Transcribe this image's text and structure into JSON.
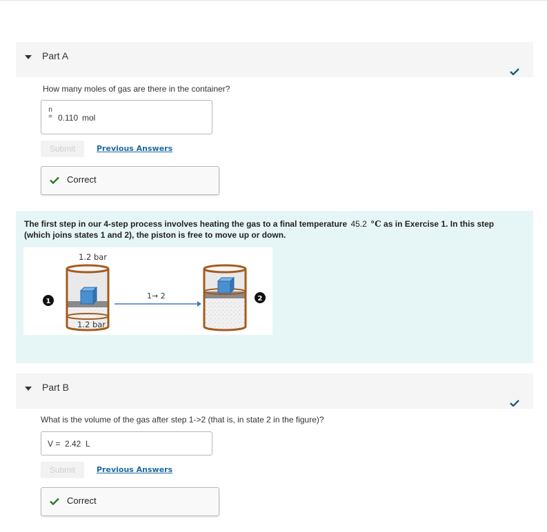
{
  "partA": {
    "title": "Part A",
    "question": "How many moles of gas are there in the container?",
    "answer_label_top": "n",
    "answer_label_bottom": "=",
    "answer_value": "0.110",
    "answer_unit": "mol",
    "submit_label": "Submit",
    "previous_answers_label": "Previous Answers",
    "feedback_label": "Correct"
  },
  "info": {
    "text_before": "The first step in our 4-step process involves heating the gas to a final temperature ",
    "temperature_value": "45.2",
    "temperature_unit": "°C",
    "text_after": " as in Exercise 1. In this step (which joins states 1 and 2), the piston is free to move up or down.",
    "figure": {
      "top_pressure": "1.2 bar",
      "bottom_pressure": "1.2 bar",
      "step_label": "1→ 2",
      "state1_marker": "1",
      "state2_marker": "2"
    }
  },
  "partB": {
    "title": "Part B",
    "question": "What is the volume of the gas after step 1->2 (that is, in state 2 in the figure)?",
    "answer_label": "V =",
    "answer_value": "2.42",
    "answer_unit": "L",
    "submit_label": "Submit",
    "previous_answers_label": "Previous Answers",
    "feedback_label": "Correct"
  },
  "colors": {
    "accent_link": "#1f6aa0",
    "check_green": "#2e7d32",
    "header_check": "#1a5c7a",
    "panel_bg": "#e6f5f5"
  }
}
